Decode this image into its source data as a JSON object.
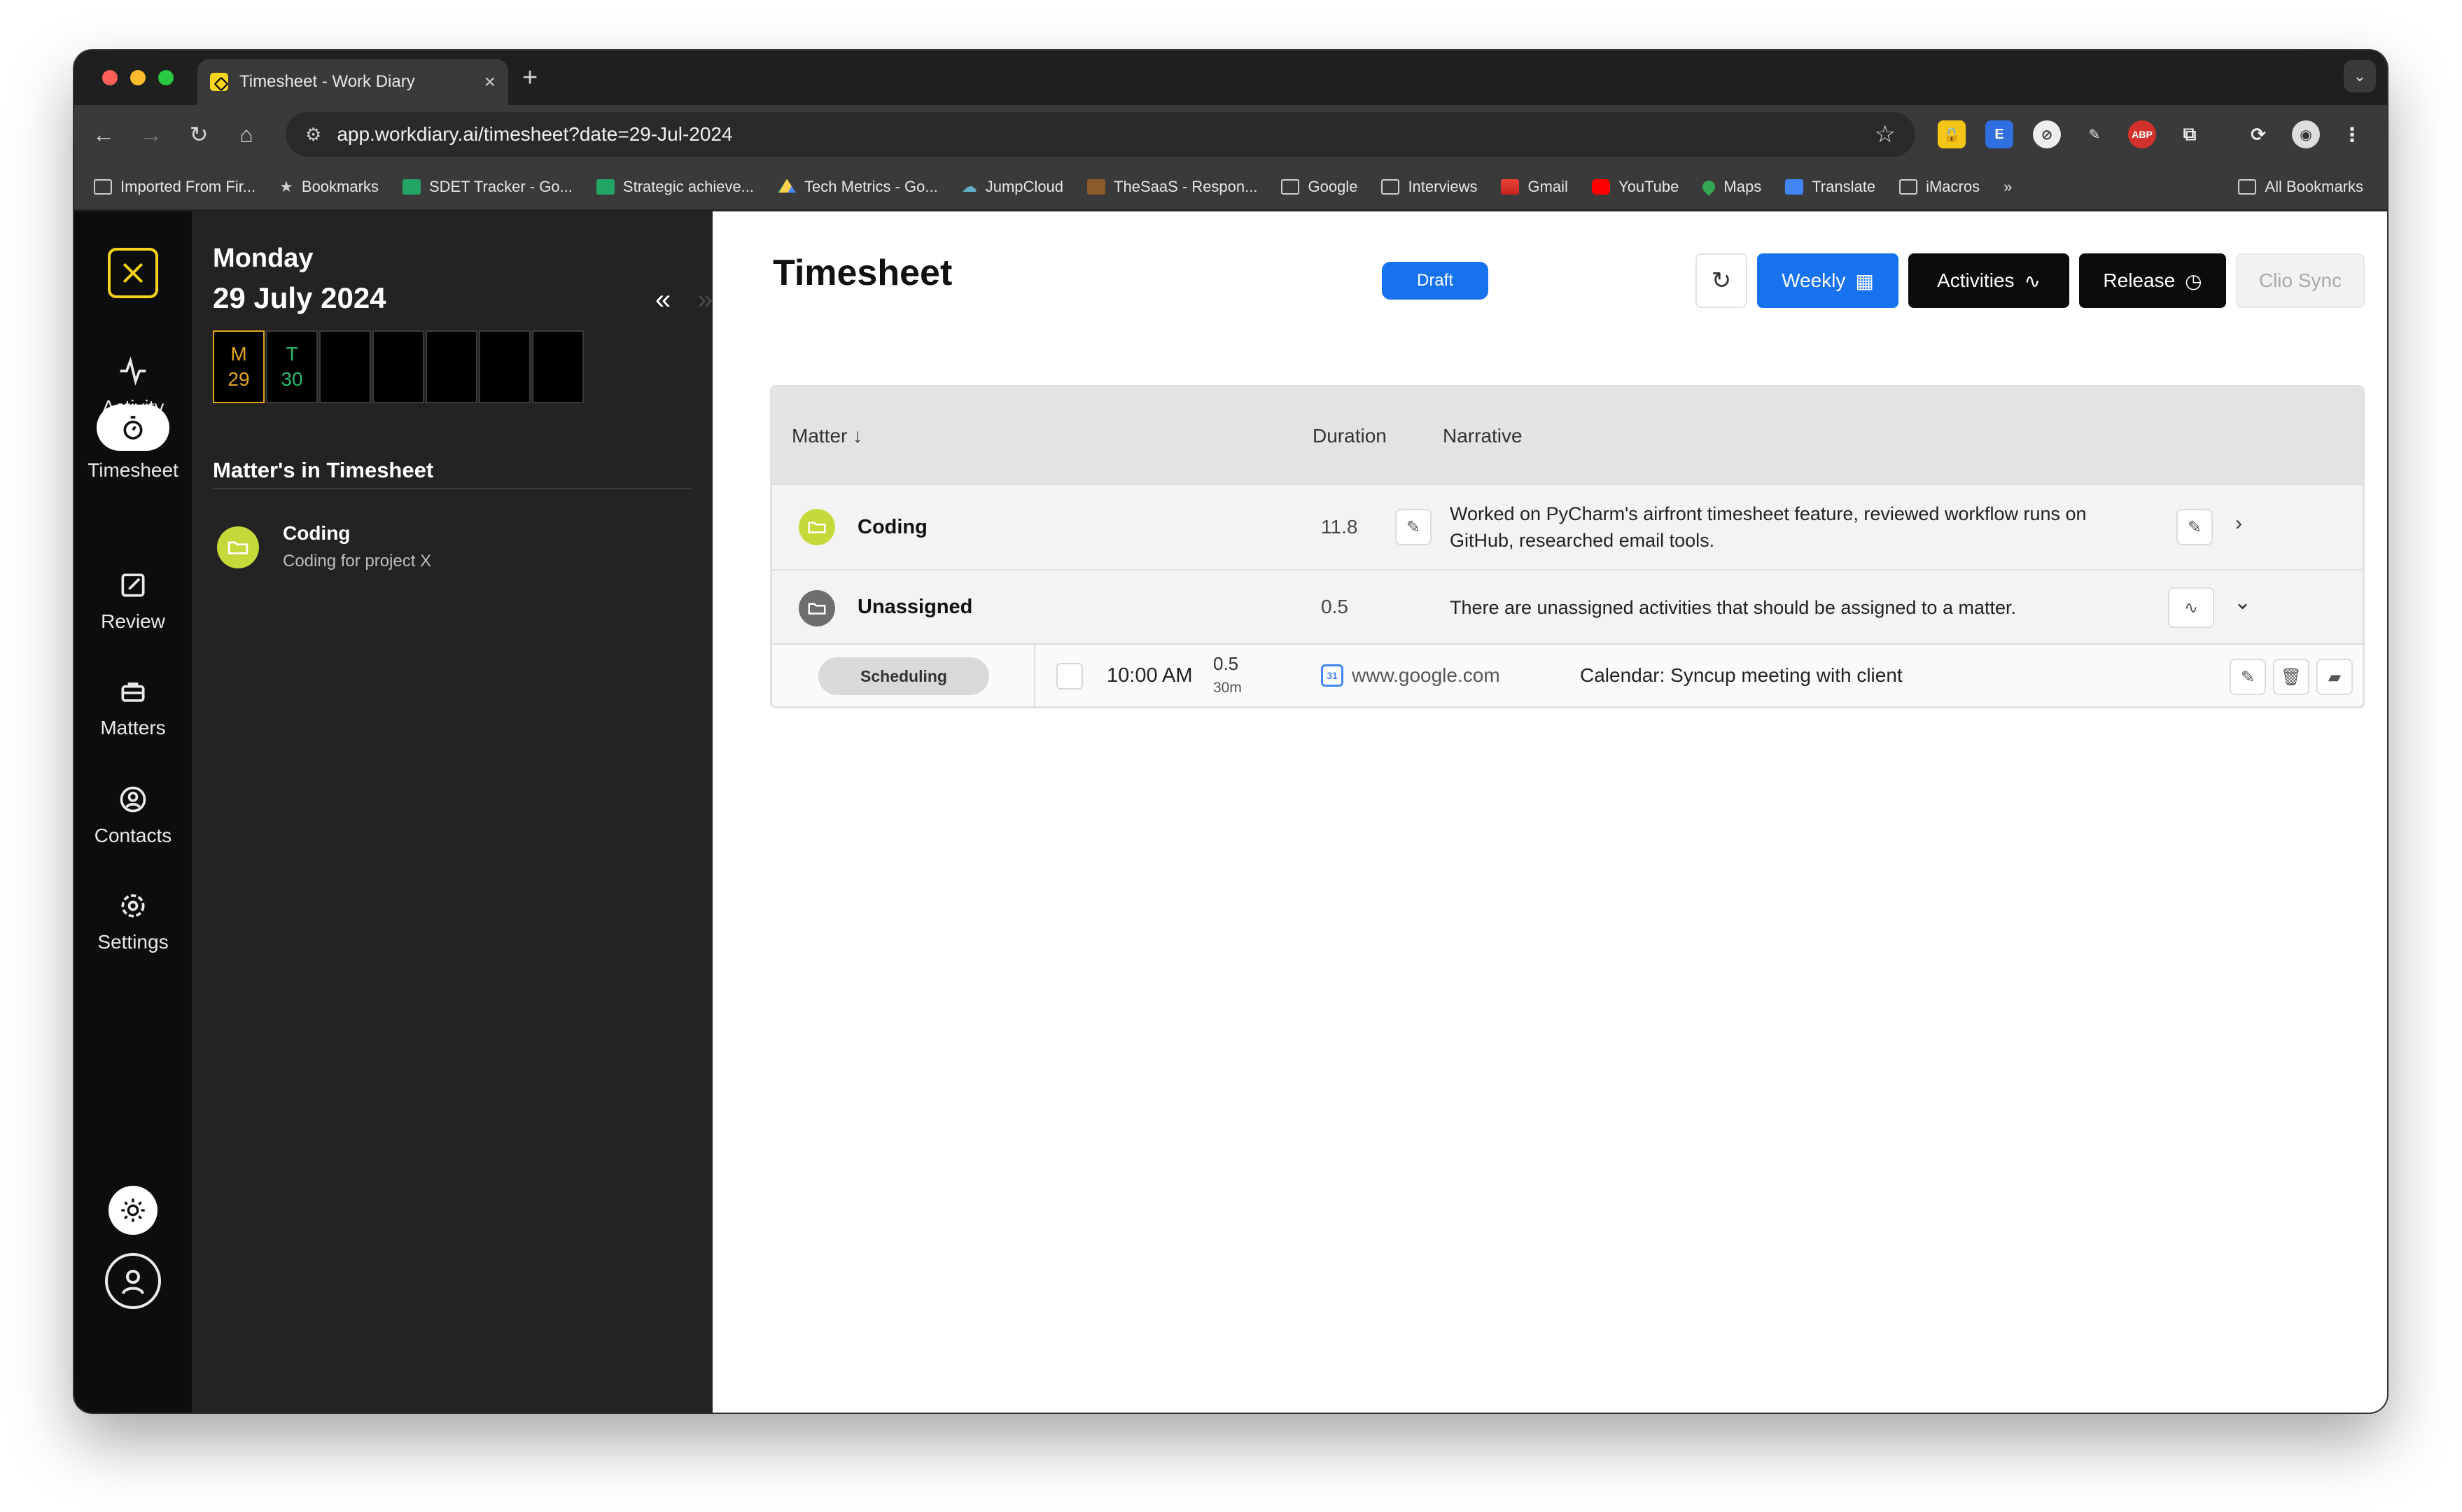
{
  "browser": {
    "tab_title": "Timesheet - Work Diary",
    "url": "app.workdiary.ai/timesheet?date=29-Jul-2024",
    "bookmarks": [
      {
        "label": "Imported From Fir...",
        "icon": "folder-icon"
      },
      {
        "label": "Bookmarks",
        "icon": "star-icon"
      },
      {
        "label": "SDET Tracker - Go...",
        "icon": "sheets-icon"
      },
      {
        "label": "Strategic achieve...",
        "icon": "sheets-icon"
      },
      {
        "label": "Tech Metrics - Go...",
        "icon": "drive-icon"
      },
      {
        "label": "JumpCloud",
        "icon": "jumpcloud-icon"
      },
      {
        "label": "TheSaaS - Respon...",
        "icon": "saas-icon"
      },
      {
        "label": "Google",
        "icon": "folder-icon"
      },
      {
        "label": "Interviews",
        "icon": "folder-icon"
      },
      {
        "label": "Gmail",
        "icon": "gmail-icon"
      },
      {
        "label": "YouTube",
        "icon": "youtube-icon"
      },
      {
        "label": "Maps",
        "icon": "maps-icon"
      },
      {
        "label": "Translate",
        "icon": "translate-icon"
      },
      {
        "label": "iMacros",
        "icon": "folder-icon"
      }
    ],
    "overflow": "»",
    "all_bookmarks": "All Bookmarks"
  },
  "rail": {
    "items": [
      {
        "label": "Activity",
        "icon": "activity-icon"
      },
      {
        "label": "Timesheet",
        "icon": "stopwatch-icon"
      },
      {
        "label": "Review",
        "icon": "edit-icon"
      },
      {
        "label": "Matters",
        "icon": "briefcase-icon"
      },
      {
        "label": "Contacts",
        "icon": "contact-icon"
      },
      {
        "label": "Settings",
        "icon": "gear-icon"
      }
    ]
  },
  "day": {
    "weekday": "Monday",
    "date": "29 July 2024",
    "week": [
      {
        "letter": "M",
        "num": "29"
      },
      {
        "letter": "T",
        "num": "30"
      },
      {
        "letter": "",
        "num": ""
      },
      {
        "letter": "",
        "num": ""
      },
      {
        "letter": "",
        "num": ""
      },
      {
        "letter": "",
        "num": ""
      },
      {
        "letter": "",
        "num": ""
      }
    ],
    "section_title": "Matter's in Timesheet",
    "matters": [
      {
        "title": "Coding",
        "subtitle": "Coding for project X"
      }
    ]
  },
  "main": {
    "title": "Timesheet",
    "status": "Draft",
    "buttons": {
      "weekly": "Weekly",
      "activities": "Activities",
      "release": "Release",
      "clio": "Clio Sync"
    },
    "columns": {
      "matter": "Matter",
      "duration": "Duration",
      "narrative": "Narrative"
    },
    "rows": [
      {
        "matter": "Coding",
        "duration": "11.8",
        "narrative": "Worked on PyCharm's airfront timesheet feature, reviewed workflow runs on GitHub, researched email tools."
      },
      {
        "matter": "Unassigned",
        "duration": "0.5",
        "narrative": "There are unassigned activities that should be assigned to a matter."
      }
    ],
    "activity": {
      "tag": "Scheduling",
      "time": "10:00 AM",
      "duration": "0.5",
      "duration_min": "30m",
      "site": "www.google.com",
      "title": "Calendar: Syncup meeting with client"
    }
  },
  "colors": {
    "accent_blue": "#1672ee",
    "brand_yellow": "#f5d31b",
    "coding_green": "#c6d93a",
    "today_orange": "#e3a31b"
  }
}
